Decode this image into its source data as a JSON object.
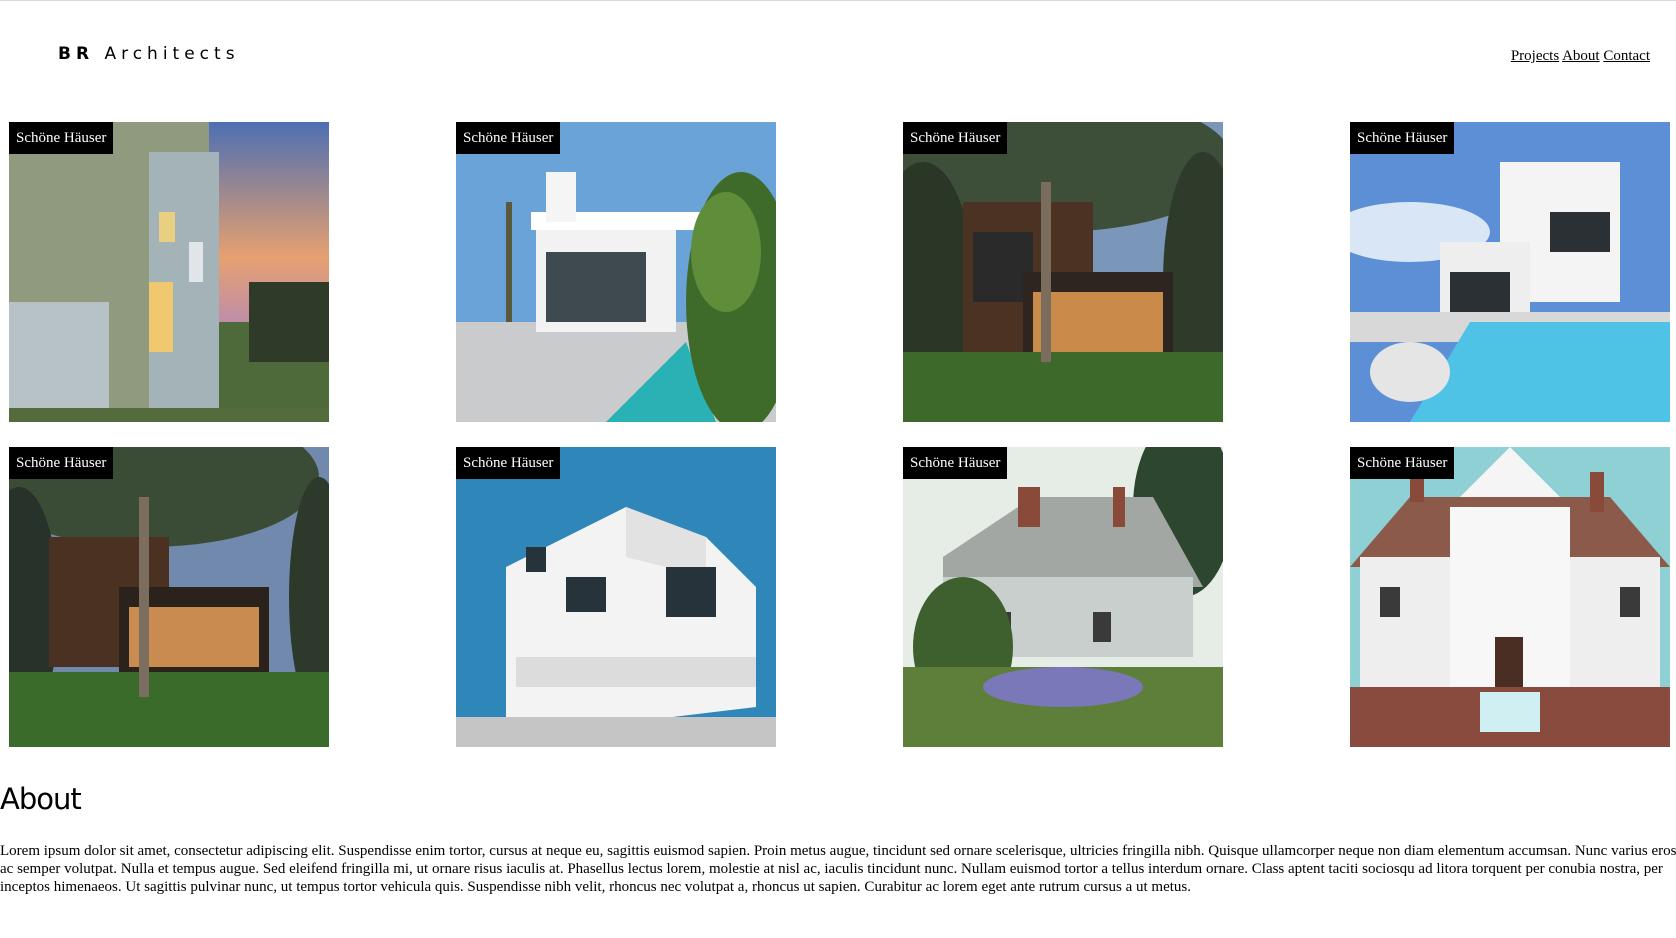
{
  "header": {
    "brand_bold": "BR",
    "brand_rest": "Architects",
    "nav": [
      "Projects",
      "About",
      "Contact"
    ]
  },
  "gallery": {
    "items": [
      {
        "label": "Schöne Häuser",
        "image": "house-sunset-green-facade"
      },
      {
        "label": "Schöne Häuser",
        "image": "modern-white-house-pool-palms"
      },
      {
        "label": "Schöne Häuser",
        "image": "modern-house-wood-glass-tree"
      },
      {
        "label": "Schöne Häuser",
        "image": "white-villa-pool-blue-sky"
      },
      {
        "label": "Schöne Häuser",
        "image": "modern-house-night-lawn"
      },
      {
        "label": "Schöne Häuser",
        "image": "white-cubic-house-blue-sky"
      },
      {
        "label": "Schöne Häuser",
        "image": "grey-cottage-garden-flowers"
      },
      {
        "label": "Schöne Häuser",
        "image": "white-colonial-house-turquoise-sky"
      }
    ]
  },
  "about": {
    "title": "About",
    "text": "Lorem ipsum dolor sit amet, consectetur adipiscing elit. Suspendisse enim tortor, cursus at neque eu, sagittis euismod sapien. Proin metus augue, tincidunt sed ornare scelerisque, ultricies fringilla nibh. Quisque ullamcorper neque non diam elementum accumsan. Nunc varius eros ac semper volutpat. Nulla et tempus augue. Sed eleifend fringilla mi, ut ornare risus iaculis at. Phasellus lectus lorem, molestie at nisl ac, iaculis tincidunt nunc. Nullam euismod tortor a tellus interdum ornare. Class aptent taciti sociosqu ad litora torquent per conubia nostra, per inceptos himenaeos. Ut sagittis pulvinar nunc, ut tempus tortor vehicula quis. Suspendisse nibh velit, rhoncus nec volutpat a, rhoncus ut sapien. Curabitur ac lorem eget ante rutrum cursus a ut metus."
  },
  "colors": {
    "background": "#ffffff",
    "tag_background": "#000000",
    "tag_text": "#ffffff"
  }
}
